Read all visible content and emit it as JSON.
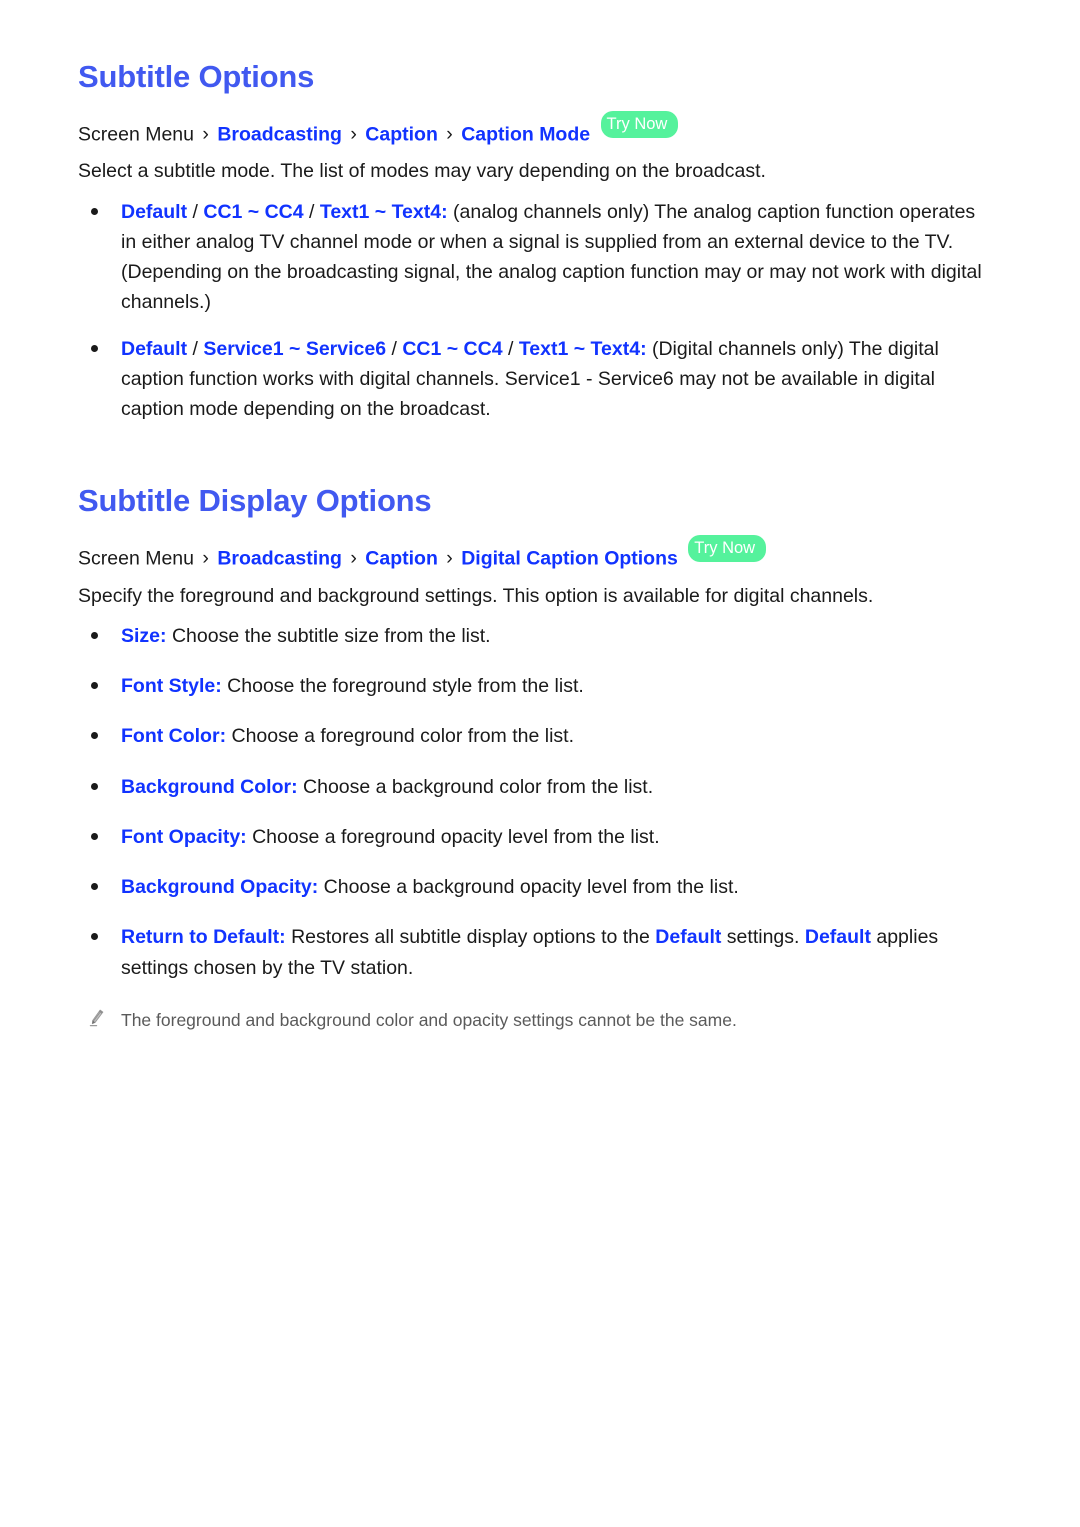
{
  "sections": [
    {
      "title": "Subtitle Options",
      "breadcrumb": {
        "root": "Screen Menu",
        "sep": "›",
        "links": [
          "Broadcasting",
          "Caption",
          "Caption Mode"
        ],
        "badge": "Try Now"
      },
      "lead": "Select a subtitle mode. The list of modes may vary depending on the broadcast.",
      "bullets": [
        {
          "keyword_parts": [
            "Default",
            "CC1 ~ CC4",
            "Text1 ~ Text4"
          ],
          "separator": " / ",
          "colon": ":",
          "text": " (analog channels only) The analog caption function operates in either analog TV channel mode or when a signal is supplied from an external device to the TV. (Depending on the broadcasting signal, the analog caption function may or may not work with digital channels.)"
        },
        {
          "keyword_parts": [
            "Default",
            "Service1 ~ Service6",
            "CC1 ~ CC4",
            "Text1 ~ Text4"
          ],
          "separator": " / ",
          "colon": ":",
          "text": " (Digital channels only) The digital caption function works with digital channels. Service1 - Service6 may not be available in digital caption mode depending on the broadcast."
        }
      ]
    },
    {
      "title": "Subtitle Display Options",
      "breadcrumb": {
        "root": "Screen Menu",
        "sep": "›",
        "links": [
          "Broadcasting",
          "Caption",
          "Digital Caption Options"
        ],
        "badge": "Try Now"
      },
      "lead": "Specify the foreground and background settings. This option is available for digital channels.",
      "bullets": [
        {
          "keyword": "Size",
          "colon": ":",
          "text": " Choose the subtitle size from the list."
        },
        {
          "keyword": "Font Style",
          "colon": ":",
          "text": " Choose the foreground style from the list."
        },
        {
          "keyword": "Font Color",
          "colon": ":",
          "text": " Choose a foreground color from the list."
        },
        {
          "keyword": "Background Color",
          "colon": ":",
          "text": " Choose a background color from the list."
        },
        {
          "keyword": "Font Opacity",
          "colon": ":",
          "text": " Choose a foreground opacity level from the list."
        },
        {
          "keyword": "Background Opacity",
          "colon": ":",
          "text": " Choose a background opacity level from the list."
        },
        {
          "keyword": "Return to Default",
          "colon": ":",
          "text_before": " Restores all subtitle display options to the ",
          "inline_kw_1": "Default",
          "text_middle": " settings. ",
          "inline_kw_2": "Default",
          "text_after": " applies settings chosen by the TV station."
        }
      ],
      "note": {
        "icon": "pencil-icon",
        "text": "The foreground and background color and opacity settings cannot be the same."
      }
    }
  ],
  "colors": {
    "heading_blue": "#4159f0",
    "link_blue": "#1133ff",
    "badge_green": "#55f29c",
    "body_black": "#1a1a1a",
    "note_gray": "#5a5a5a"
  }
}
